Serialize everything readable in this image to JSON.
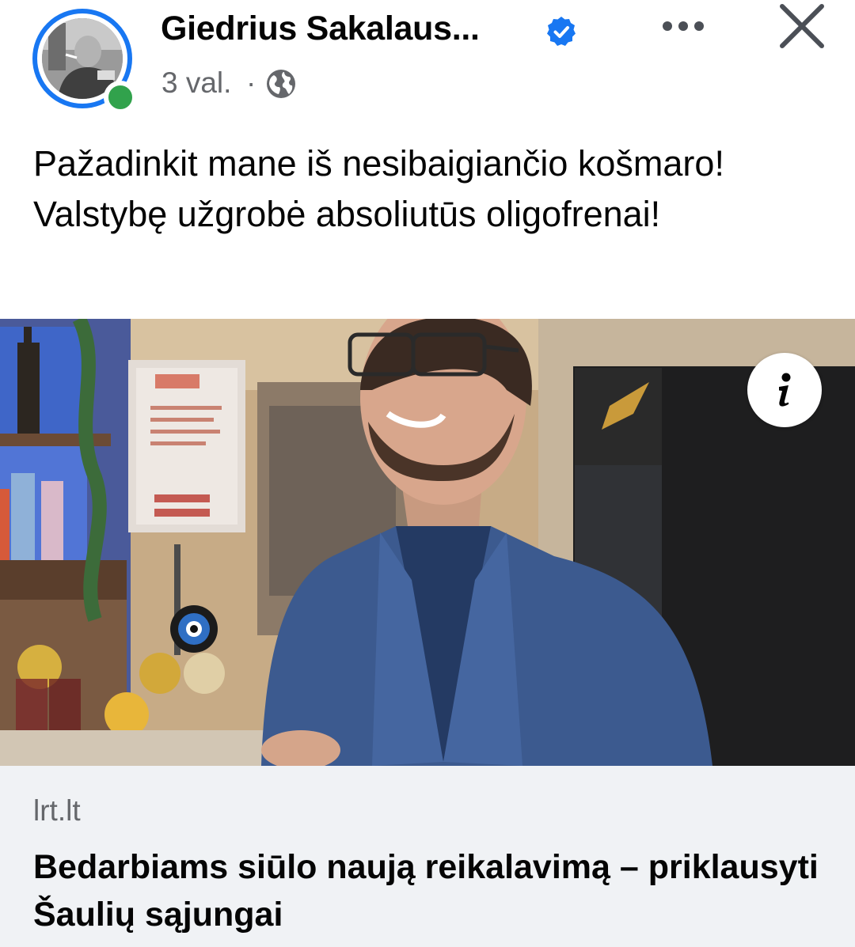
{
  "author": {
    "name": "Giedrius Sakalaus...",
    "verified": true,
    "online": true
  },
  "meta": {
    "time": "3 val.",
    "separator": "·",
    "audience_icon": "globe-icon"
  },
  "post": {
    "text": "Pažadinkit mane iš nesibaigiančio košmaro! Valstybę užgrobė absoliutūs oligofrenai!"
  },
  "link_preview": {
    "domain": "lrt.lt",
    "title": "Bedarbiams siūlo naują reikalavimą – priklausyti Šaulių sąjungai",
    "info_icon": "info-icon"
  },
  "icons": {
    "more": "more-options-icon",
    "close": "close-icon",
    "verified": "verified-badge-icon"
  },
  "colors": {
    "accent": "#1877f2",
    "online": "#31a24c",
    "secondary_text": "#65676b",
    "card_background": "#f0f2f5"
  }
}
